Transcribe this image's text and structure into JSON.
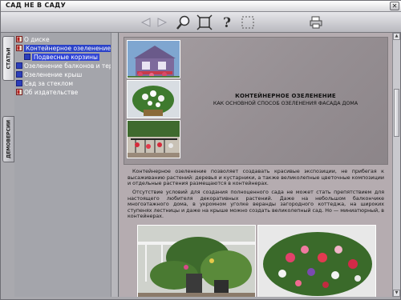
{
  "window": {
    "title": "САД НЕ В САДУ",
    "close_glyph": "✕"
  },
  "toolbar": {
    "buttons": [
      {
        "name": "back-arrow-icon"
      },
      {
        "name": "forward-arrow-icon"
      },
      {
        "name": "magnifier-icon"
      },
      {
        "name": "fullscreen-icon"
      },
      {
        "name": "help-icon"
      },
      {
        "name": "select-frame-icon"
      },
      {
        "name": "print-icon"
      }
    ]
  },
  "tabs": [
    {
      "label": "СТАТЬИ",
      "active": true
    },
    {
      "label": "ДЕМОВЕРСИИ",
      "active": false
    }
  ],
  "tree": {
    "items": [
      {
        "label": "О диске",
        "level": 0,
        "selected": false
      },
      {
        "label": "Контейнерное озеленение",
        "level": 0,
        "selected": true
      },
      {
        "label": "Подвесные корзины",
        "level": 1,
        "selected": true
      },
      {
        "label": "Озеленение балконов и тер",
        "level": 0,
        "selected": false
      },
      {
        "label": "Озеленение крыш",
        "level": 0,
        "selected": false
      },
      {
        "label": "Сад за стеклом",
        "level": 0,
        "selected": false
      },
      {
        "label": "Об издательстве",
        "level": 0,
        "selected": false
      }
    ]
  },
  "article": {
    "title": "КОНТЕЙНЕРНОЕ ОЗЕЛЕНЕНИЕ",
    "subtitle": "КАК ОСНОВНОЙ СПОСОБ ОЗЕЛЕНЕНИЯ ФАСАДА ДОМА",
    "paragraph1": "Контейнерное озеленение позволяет создавать красивые экспозиции, не прибегая к высаживанию растений: деревья и кустарники, а также великолепные цветочные композиции и отдельные растения размещаются в контейнерах.",
    "paragraph2": "Отсутствие условий для создания полноценного сада не может стать препятствием для настоящего любителя декоративных растений. Даже на небольшом балкончике многоэтажного дома, в укромном уголке веранды загородного коттеджа, на широких ступенях лестницы и даже на крыше можно создать великолепный сад. Но — миниатюрный, в контейнерах."
  }
}
